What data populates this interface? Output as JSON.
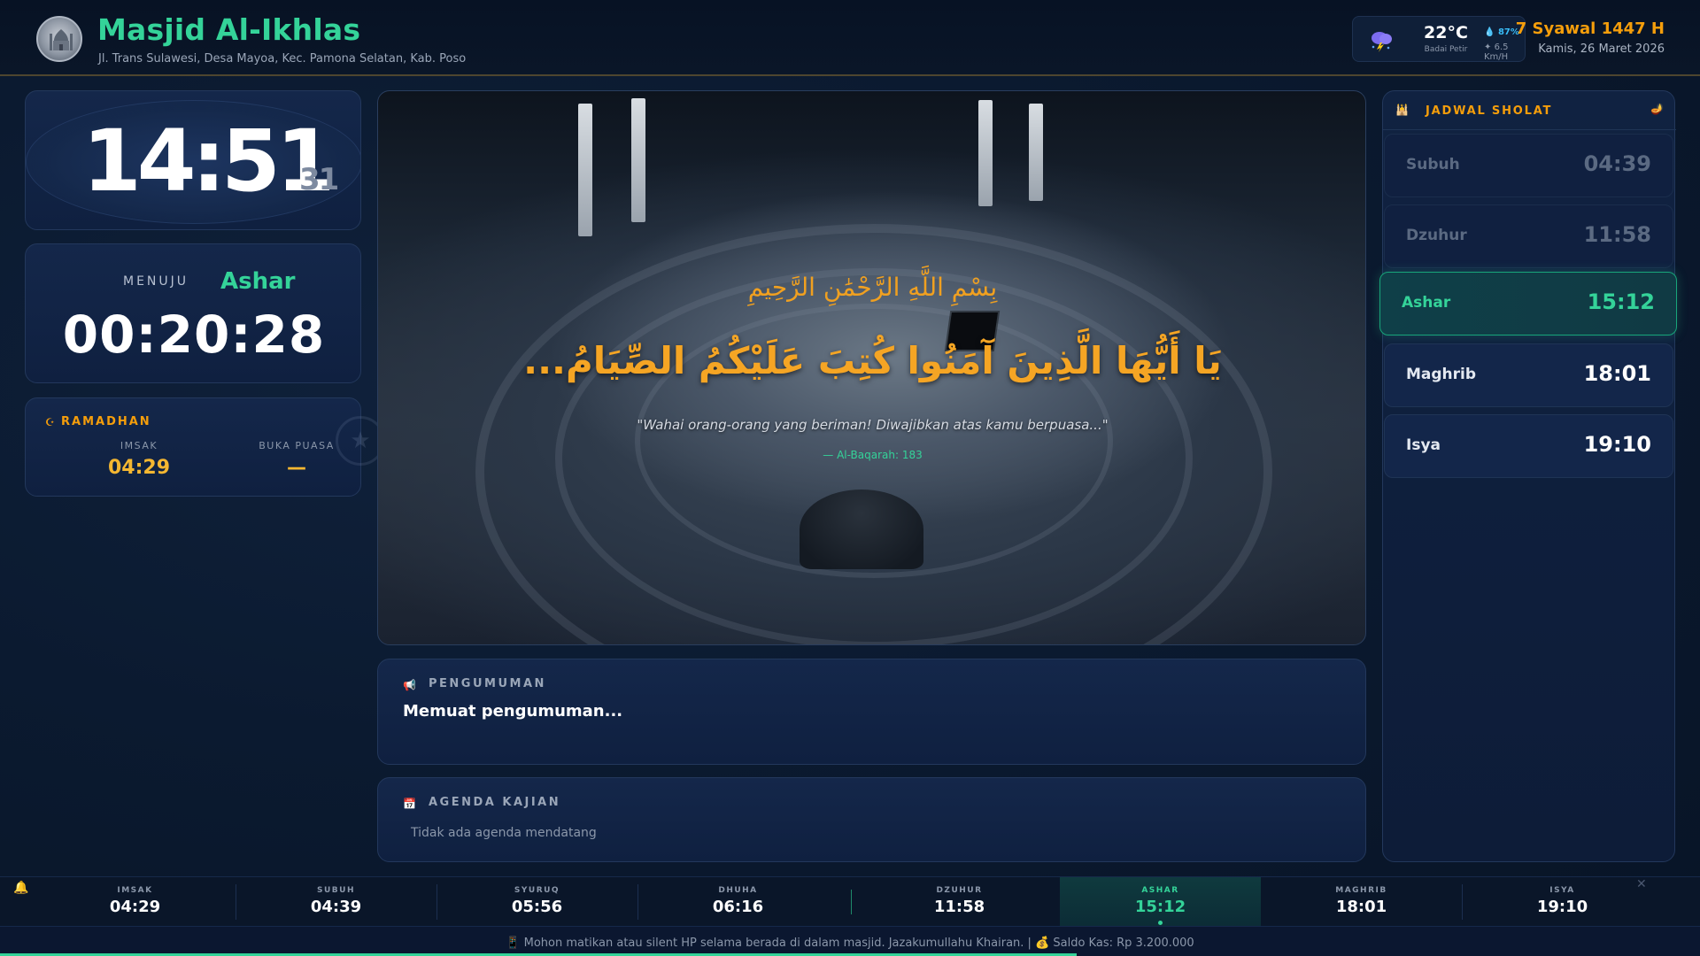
{
  "header": {
    "mosque_name": "Masjid Al-Ikhlas",
    "address": "Jl. Trans Sulawesi, Desa Mayoa, Kec. Pamona Selatan, Kab. Poso",
    "weather": {
      "temp": "22°C",
      "condition": "Badai Petir",
      "humidity": "87%",
      "wind": "6.5 Km/H",
      "icon": "thunderstorm-icon"
    },
    "hijri_date": "7 Syawal 1447 H",
    "gregorian_date": "Kamis, 26 Maret 2026"
  },
  "clock": {
    "hhmm": "14:51",
    "seconds": "31"
  },
  "next_prayer": {
    "label": "MENUJU",
    "name": "Ashar",
    "countdown": "00:20:28"
  },
  "ramadhan": {
    "title": "RAMADHAN",
    "imsak_label": "IMSAK",
    "imsak_value": "04:29",
    "buka_label": "BUKA PUASA",
    "buka_value": "—"
  },
  "hero": {
    "basmala": "بِسْمِ اللَّهِ الرَّحْمَٰنِ الرَّحِيمِ",
    "ayah": "يَا أَيُّهَا الَّذِينَ آمَنُوا كُتِبَ عَلَيْكُمُ الصِّيَامُ...",
    "translation": "\"Wahai orang-orang yang beriman! Diwajibkan atas kamu berpuasa...\"",
    "reference": "— Al-Baqarah: 183"
  },
  "announcement": {
    "title": "PENGUMUMAN",
    "text": "Memuat pengumuman..."
  },
  "agenda": {
    "title": "AGENDA KAJIAN",
    "text": "Tidak ada agenda mendatang"
  },
  "schedule": {
    "title": "JADWAL SHOLAT",
    "prayers": [
      {
        "name": "Subuh",
        "time": "04:39",
        "state": "past"
      },
      {
        "name": "Dzuhur",
        "time": "11:58",
        "state": "past"
      },
      {
        "name": "Ashar",
        "time": "15:12",
        "state": "active"
      },
      {
        "name": "Maghrib",
        "time": "18:01",
        "state": "upcoming"
      },
      {
        "name": "Isya",
        "time": "19:10",
        "state": "upcoming"
      }
    ]
  },
  "bottom_bar": [
    {
      "label": "IMSAK",
      "time": "04:29"
    },
    {
      "label": "SUBUH",
      "time": "04:39"
    },
    {
      "label": "SYURUQ",
      "time": "05:56"
    },
    {
      "label": "DHUHA",
      "time": "06:16"
    },
    {
      "label": "DZUHUR",
      "time": "11:58"
    },
    {
      "label": "ASHAR",
      "time": "15:12"
    },
    {
      "label": "MAGHRIB",
      "time": "18:01"
    },
    {
      "label": "ISYA",
      "time": "19:10"
    }
  ],
  "ticker": {
    "message": "Mohon matikan atau silent HP selama berada di dalam masjid. Jazakumullahu Khairan. |",
    "balance": "Saldo Kas: Rp 3.200.000"
  },
  "colors": {
    "accent_green": "#34d399",
    "accent_gold": "#f59e0b",
    "background": "#0b1a30"
  }
}
